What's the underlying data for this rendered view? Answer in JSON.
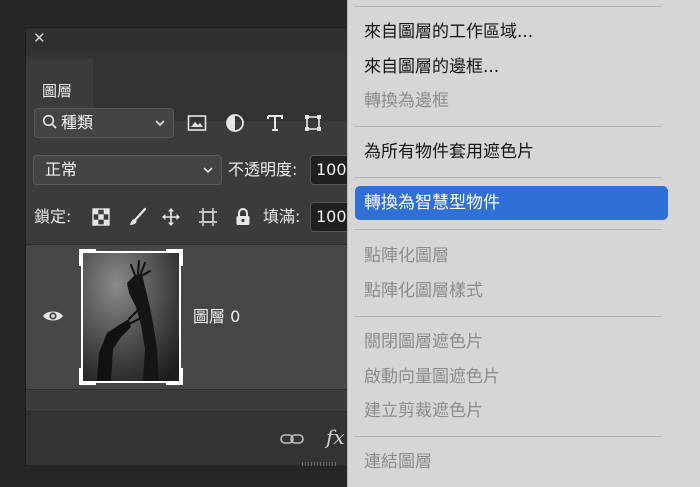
{
  "layers_panel": {
    "close_glyph": "✕",
    "tab_label": "圖層",
    "filter": {
      "value": "種類",
      "icon": "search-icon"
    },
    "filter_icons": [
      "image-filter-icon",
      "adjustment-filter-icon",
      "type-filter-icon",
      "shape-filter-icon"
    ],
    "blend_mode": "正常",
    "opacity_label": "不透明度:",
    "opacity_value": "100",
    "lock_label": "鎖定:",
    "lock_icons": [
      "lock-transparent-icon",
      "lock-paint-icon",
      "lock-position-icon",
      "lock-artboard-icon",
      "lock-all-icon"
    ],
    "fill_label": "填滿:",
    "fill_value": "100",
    "layers": [
      {
        "name": "圖層 0",
        "visible": true
      }
    ],
    "footer": {
      "fx_label": "fx"
    }
  },
  "context_menu": {
    "items": [
      {
        "label": "來自圖層的工作區域...",
        "enabled": true
      },
      {
        "label": "來自圖層的邊框...",
        "enabled": true
      },
      {
        "label": "轉換為邊框",
        "enabled": false
      },
      {
        "label": "為所有物件套用遮色片",
        "enabled": true
      },
      {
        "label": "轉換為智慧型物件",
        "enabled": true,
        "highlighted": true
      },
      {
        "label": "點陣化圖層",
        "enabled": false
      },
      {
        "label": "點陣化圖層樣式",
        "enabled": false
      },
      {
        "label": "關閉圖層遮色片",
        "enabled": false
      },
      {
        "label": "啟動向量圖遮色片",
        "enabled": false
      },
      {
        "label": "建立剪裁遮色片",
        "enabled": false
      },
      {
        "label": "連結圖層",
        "enabled": false
      }
    ],
    "highlight_color": "#2f6fd6"
  }
}
